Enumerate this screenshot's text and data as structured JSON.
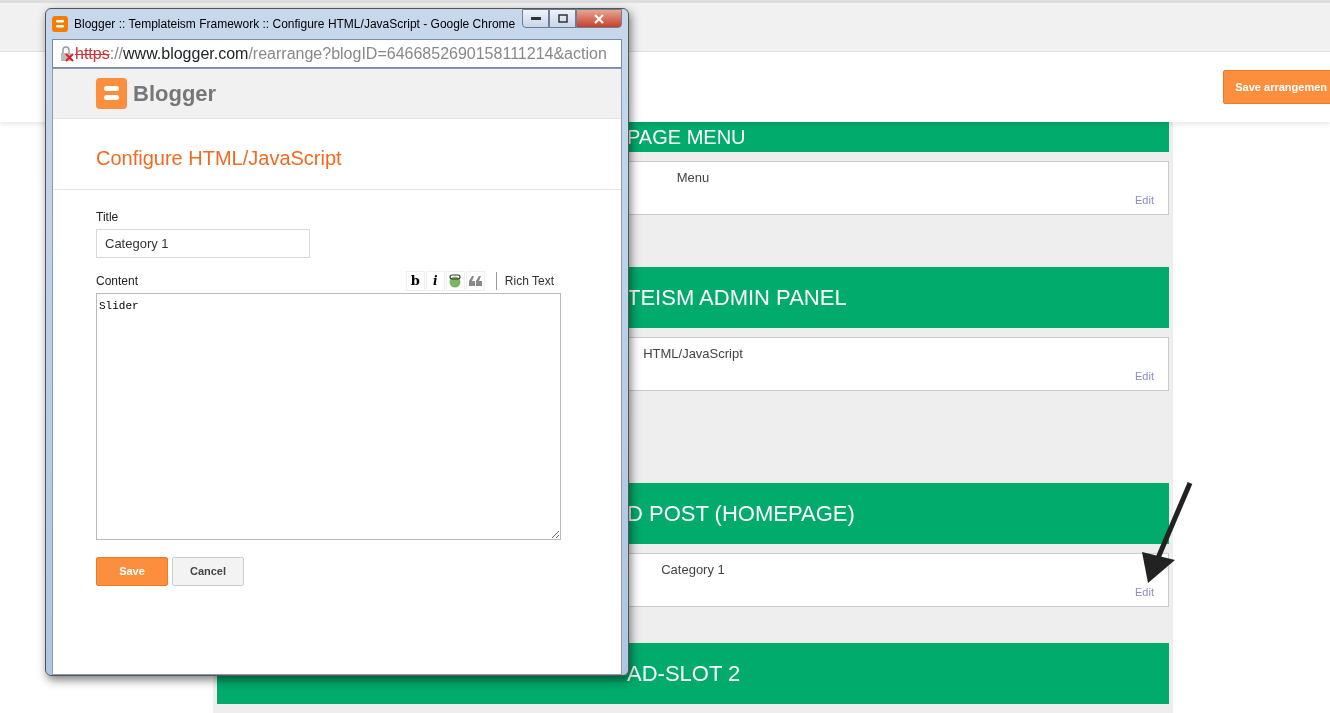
{
  "page": {
    "save_button": "Save arrangemen",
    "sections": [
      {
        "heading": "PAGE MENU",
        "widgets": [
          {
            "name": "Menu",
            "action": "Edit"
          }
        ]
      },
      {
        "heading": "TEISM ADMIN PANEL",
        "widgets": [
          {
            "name": "HTML/JavaScript",
            "action": "Edit"
          }
        ]
      },
      {
        "heading": "D POST (HOMEPAGE)",
        "widgets": [
          {
            "name": "Category 1",
            "action": "Edit"
          }
        ]
      },
      {
        "heading": "AD-SLOT 2"
      }
    ]
  },
  "popup_window": {
    "title": "Blogger :: Templateism Framework :: Configure HTML/JavaScript - Google Chrome",
    "url": {
      "scheme": "https",
      "rest": "://",
      "host": "www.blogger.com",
      "path": "/rearrange?blogID=6466852690158111214&action",
      "certificate_error": true
    },
    "logo_text": "Blogger",
    "dialog_title": "Configure HTML/JavaScript",
    "title_field": {
      "label": "Title",
      "value": "Category 1"
    },
    "content_field": {
      "label": "Content",
      "value": "Slider",
      "toolbar": [
        {
          "kind": "bold",
          "label": "b"
        },
        {
          "kind": "italic",
          "label": "i"
        },
        {
          "kind": "link"
        },
        {
          "kind": "quote"
        }
      ],
      "rich_text_link": "Rich Text"
    },
    "buttons": [
      {
        "label": "Save",
        "kind": "primary"
      },
      {
        "label": "Cancel",
        "kind": "secondary"
      }
    ]
  }
}
